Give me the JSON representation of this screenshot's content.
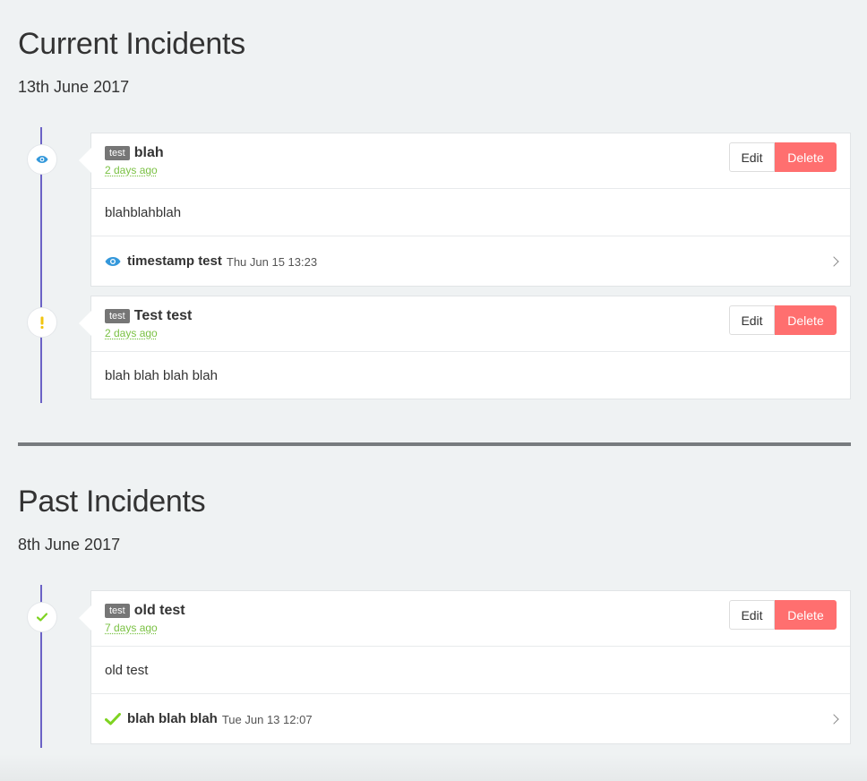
{
  "current": {
    "heading": "Current Incidents",
    "date": "13th June 2017",
    "incidents": [
      {
        "tag": "test",
        "title": "blah",
        "time": "2 days ago",
        "body": "blahblahblah",
        "status_icon": "eye-icon",
        "update": {
          "icon": "eye-icon",
          "title": "timestamp test",
          "time": "Thu Jun 15 13:23"
        }
      },
      {
        "tag": "test",
        "title": "Test test",
        "time": "2 days ago",
        "body": "blah blah blah blah",
        "status_icon": "exclamation-icon"
      }
    ]
  },
  "past": {
    "heading": "Past Incidents",
    "date": "8th June 2017",
    "incidents": [
      {
        "tag": "test",
        "title": "old test",
        "time": "7 days ago",
        "body": "old test",
        "status_icon": "check-icon",
        "update": {
          "icon": "check-icon",
          "title": "blah blah blah",
          "time": "Tue Jun 13 12:07"
        }
      }
    ]
  },
  "buttons": {
    "edit": "Edit",
    "delete": "Delete"
  },
  "colors": {
    "timeline": "#6b62c6",
    "delete": "#ff6f6f",
    "time_link": "#7ac143",
    "eye": "#3498db",
    "warning": "#f1c40f",
    "check": "#7ed321"
  }
}
